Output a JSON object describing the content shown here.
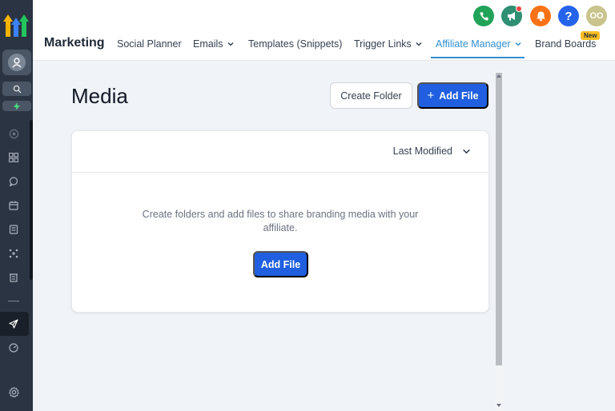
{
  "header": {
    "module_title": "Marketing",
    "tabs": [
      {
        "label": "Social Planner",
        "has_dropdown": false,
        "active": false
      },
      {
        "label": "Emails",
        "has_dropdown": true,
        "active": false
      },
      {
        "label": "Templates (Snippets)",
        "has_dropdown": false,
        "active": false
      },
      {
        "label": "Trigger Links",
        "has_dropdown": true,
        "active": false
      },
      {
        "label": "Affiliate Manager",
        "has_dropdown": true,
        "active": true
      },
      {
        "label": "Brand Boards",
        "has_dropdown": false,
        "active": false
      }
    ],
    "new_badge": "New",
    "user_initials": "OO",
    "help_glyph": "?",
    "action_icons": [
      "phone-icon",
      "megaphone-icon",
      "bell-icon",
      "help-icon",
      "user-avatar"
    ]
  },
  "sidebar": {
    "icons": [
      "logo",
      "user-avatar-icon",
      "search-icon",
      "bolt-icon",
      "target-icon",
      "grid-icon",
      "chat-icon",
      "calendar-icon",
      "contacts-icon",
      "network-icon",
      "bank-icon",
      "send-icon",
      "gauge-icon",
      "gear-icon"
    ],
    "active_item": "send-icon"
  },
  "main": {
    "page_title": "Media",
    "create_folder_label": "Create Folder",
    "add_file_label": "Add File",
    "add_file_plus": "+",
    "sort_label": "Last Modified",
    "empty_message": "Create folders and add files to share branding media with your affiliate.",
    "empty_add_file_label": "Add File"
  },
  "colors": {
    "sidebar_bg": "#2b3442",
    "primary": "#1f5fe0",
    "active_tab": "#2f8fd1",
    "phone": "#22a35a",
    "megaphone": "#2f8f72",
    "bell": "#f97316",
    "help": "#2563eb",
    "user": "#c9c48d",
    "badge": "#fbbf24"
  }
}
